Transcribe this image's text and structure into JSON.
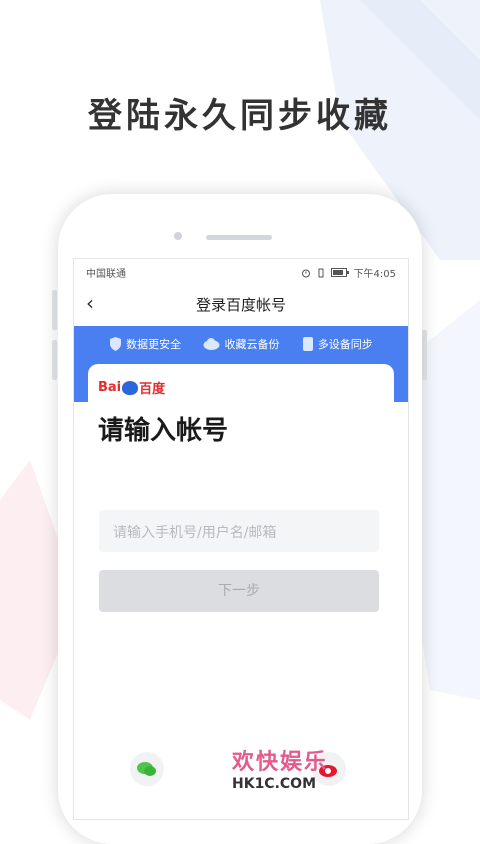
{
  "headline": "登陆永久同步收藏",
  "status_bar": {
    "carrier": "中国联通",
    "time": "下午4:05"
  },
  "nav": {
    "back_icon": "chevron-left-icon",
    "title": "登录百度帐号"
  },
  "banner": {
    "features": [
      {
        "icon": "shield-icon",
        "label": "数据更安全"
      },
      {
        "icon": "cloud-icon",
        "label": "收藏云备份"
      },
      {
        "icon": "device-icon",
        "label": "多设备同步"
      }
    ]
  },
  "card": {
    "logo_left": "Bai",
    "logo_mid": "du",
    "logo_right": "百度",
    "title": "请输入帐号",
    "input_placeholder": "请输入手机号/用户名/邮箱",
    "next_label": "下一步"
  },
  "watermark": {
    "text": "欢快娱乐",
    "url": "HK1C.COM"
  },
  "colors": {
    "banner_blue": "#4a7ff2",
    "logo_red": "#e22d2d",
    "logo_blue": "#2b67d9",
    "button_disabled": "#dcdde0"
  }
}
